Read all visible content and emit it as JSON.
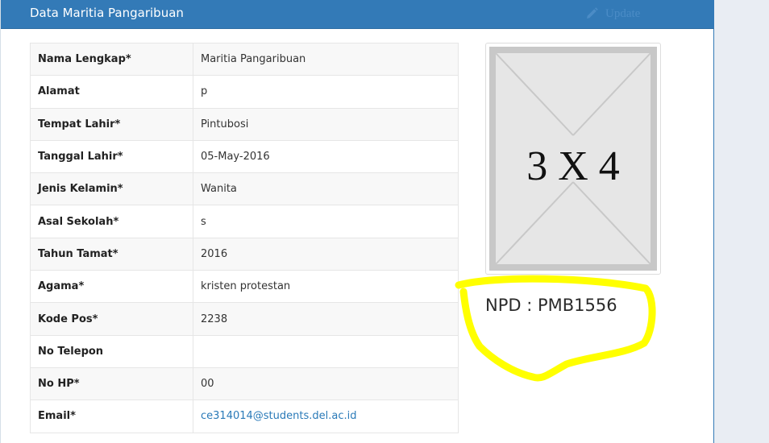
{
  "panel": {
    "title": "Data Maritia Pangaribuan",
    "update_label": "Update"
  },
  "fields": [
    {
      "label": "Nama Lengkap*",
      "value": "Maritia Pangaribuan"
    },
    {
      "label": "Alamat",
      "value": "p"
    },
    {
      "label": "Tempat Lahir*",
      "value": "Pintubosi"
    },
    {
      "label": "Tanggal Lahir*",
      "value": "05-May-2016"
    },
    {
      "label": "Jenis Kelamin*",
      "value": "Wanita"
    },
    {
      "label": "Asal Sekolah*",
      "value": "s"
    },
    {
      "label": "Tahun Tamat*",
      "value": "2016"
    },
    {
      "label": "Agama*",
      "value": "kristen protestan"
    },
    {
      "label": "Kode Pos*",
      "value": "2238"
    },
    {
      "label": "No Telepon",
      "value": ""
    },
    {
      "label": "No HP*",
      "value": "00"
    },
    {
      "label": "Email*",
      "value": "ce314014@students.del.ac.id"
    }
  ],
  "photo": {
    "placeholder_text": "3 X 4"
  },
  "npd": "NPD : PMB1556",
  "icons": {
    "update": "pencil-icon"
  },
  "colors": {
    "header": "#337ab7",
    "link": "#2a7ab8",
    "highlight": "#ffff00"
  }
}
